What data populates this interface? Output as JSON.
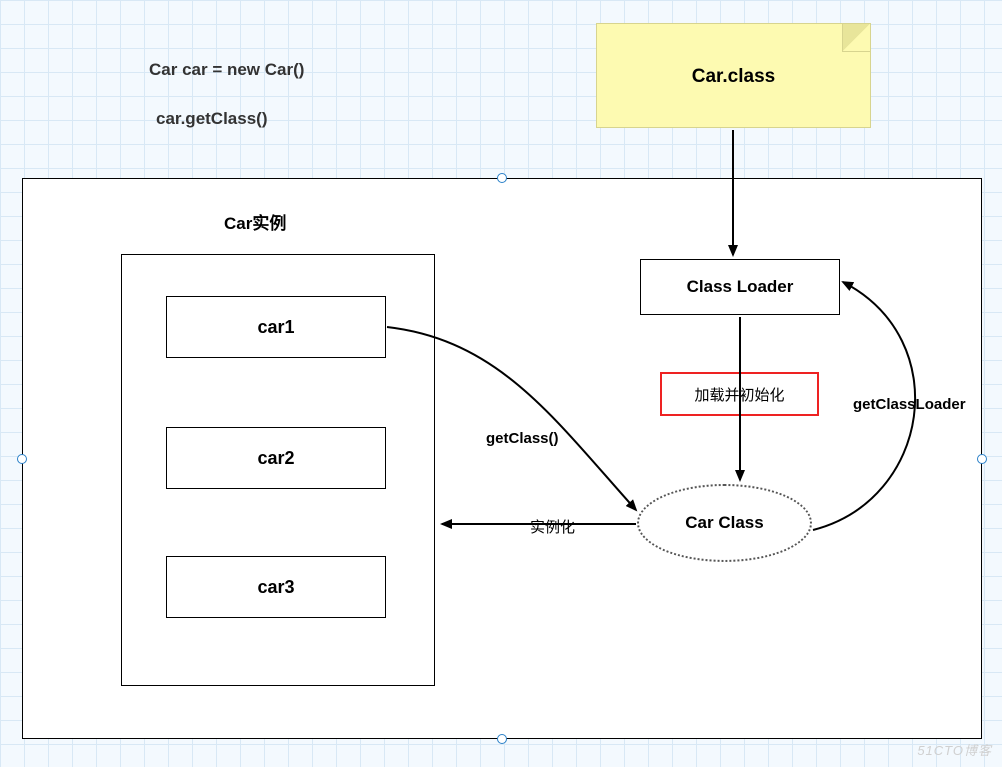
{
  "code": {
    "line1": "Car car = new Car()",
    "line2": "car.getClass()"
  },
  "sticky": {
    "label": "Car.class"
  },
  "outerContainer": {
    "header": "Car实例",
    "instances": [
      "car1",
      "car2",
      "car3"
    ]
  },
  "classLoader": {
    "label": "Class Loader"
  },
  "loadInit": {
    "label": "加载并初始化"
  },
  "carClass": {
    "label": "Car  Class"
  },
  "edges": {
    "getClass": "getClass()",
    "instantiate": "实例化",
    "getClassLoader": "getClassLoader"
  },
  "watermark": "51CTO博客"
}
